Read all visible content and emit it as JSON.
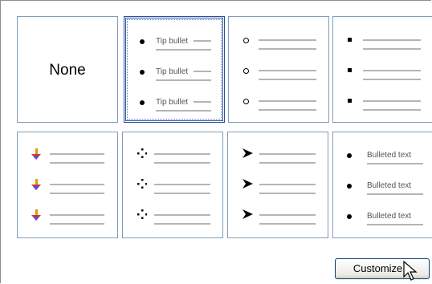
{
  "gallery": {
    "none_label": "None",
    "tip_bullet_text": "Tip bullet",
    "bulleted_text": "Bulleted text"
  },
  "icons": {
    "filled_round": "bullet-dot-icon",
    "hollow_round": "bullet-ring-icon",
    "filled_square": "bullet-square-icon",
    "colored_arrow": "colored-arrow-bullet-icon",
    "four_diamond": "four-diamond-bullet-icon",
    "arrowhead": "arrowhead-bullet-icon"
  },
  "buttons": {
    "customize_label": "Customize..."
  },
  "colors": {
    "tile_border": "#7f9db9",
    "selected_border": "#2a4f9c"
  }
}
